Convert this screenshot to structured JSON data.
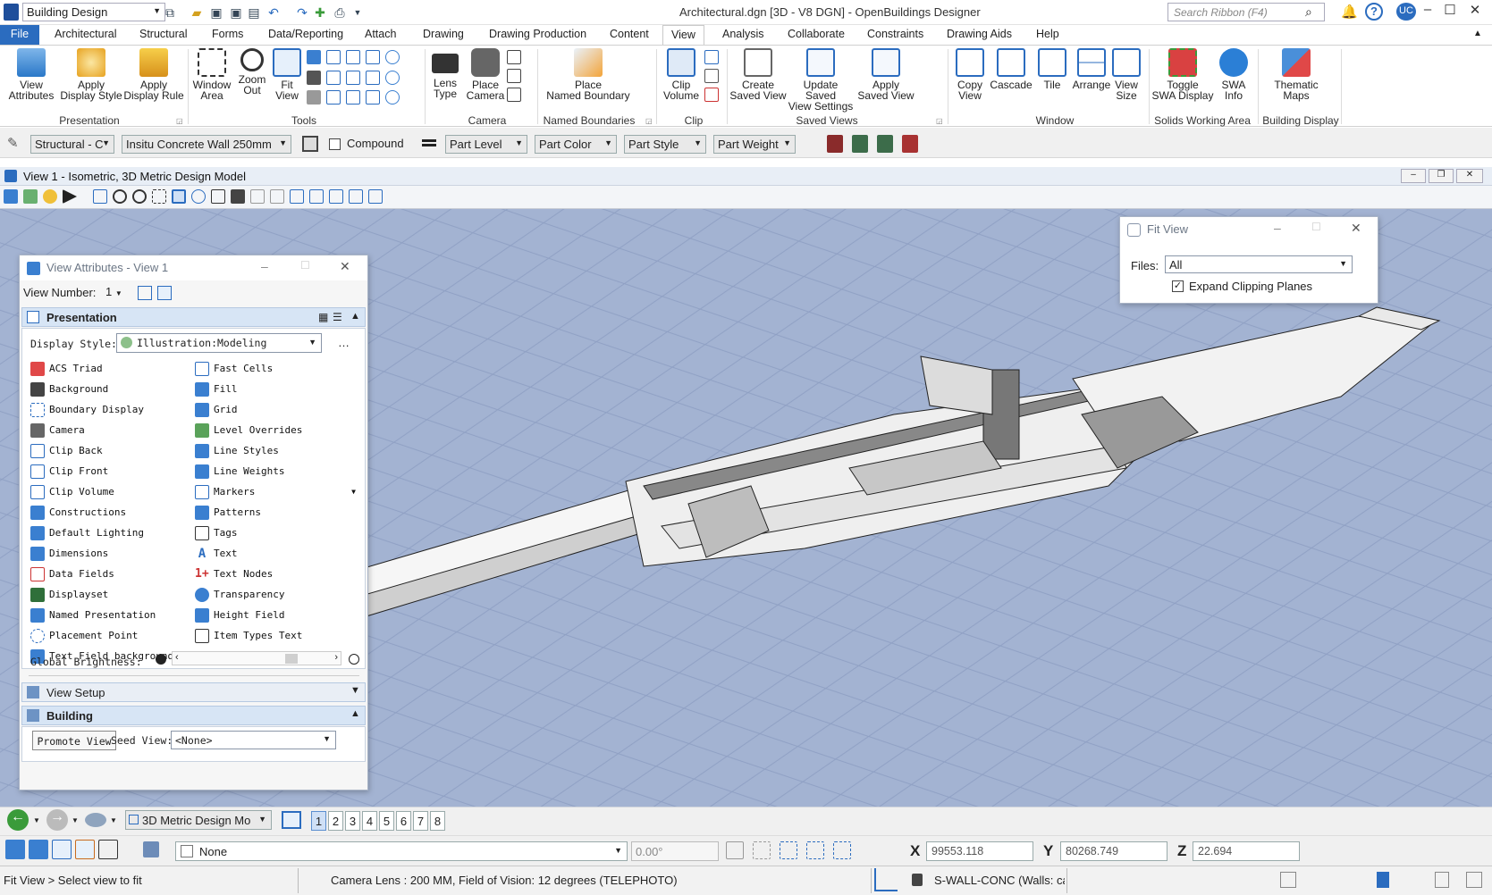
{
  "titlebar": {
    "workspace": "Building Design",
    "title": "Architectural.dgn [3D - V8 DGN] - OpenBuildings Designer",
    "search_placeholder": "Search Ribbon (F4)",
    "user_initials": "UC"
  },
  "tabs": [
    "File",
    "Architectural",
    "Structural",
    "Forms",
    "Data/Reporting",
    "Attach",
    "Drawing",
    "Drawing Production",
    "Content",
    "View",
    "Analysis",
    "Collaborate",
    "Constraints",
    "Drawing Aids",
    "Help"
  ],
  "ribbon": {
    "presentation": {
      "label": "Presentation",
      "view_attributes": "View\nAttributes",
      "apply_display_style": "Apply\nDisplay Style",
      "apply_display_rule": "Apply\nDisplay Rule"
    },
    "tools": {
      "label": "Tools",
      "window_area": "Window\nArea",
      "zoom_out": "Zoom\nOut",
      "fit_view": "Fit\nView"
    },
    "camera": {
      "label": "Camera",
      "lens_type": "Lens\nType",
      "place_camera": "Place\nCamera"
    },
    "named_boundaries": {
      "label": "Named Boundaries",
      "place": "Place\nNamed Boundary"
    },
    "clip": {
      "label": "Clip",
      "clip_volume": "Clip\nVolume"
    },
    "saved_views": {
      "label": "Saved Views",
      "create": "Create\nSaved View",
      "update": "Update Saved\nView Settings",
      "apply": "Apply\nSaved View"
    },
    "window": {
      "label": "Window",
      "copy_view": "Copy\nView",
      "cascade": "Cascade",
      "tile": "Tile",
      "arrange": "Arrange",
      "view_size": "View\nSize"
    },
    "swa": {
      "label": "Solids Working Area",
      "toggle": "Toggle\nSWA Display",
      "info": "SWA\nInfo"
    },
    "building_display": {
      "label": "Building Display",
      "thematic_maps": "Thematic\nMaps"
    }
  },
  "attrbar": {
    "family": "Structural - C",
    "part": "Insitu Concrete Wall 250mm",
    "compound": "Compound",
    "part_level": "Part Level",
    "part_color": "Part Color",
    "part_style": "Part Style",
    "part_weight": "Part Weight"
  },
  "view": {
    "title": "View 1 - Isometric, 3D Metric Design Model"
  },
  "fit_view_dialog": {
    "title": "Fit View",
    "files_label": "Files:",
    "files_value": "All",
    "expand_clipping": "Expand Clipping Planes",
    "expand_checked": true
  },
  "view_attributes_dialog": {
    "title": "View Attributes - View 1",
    "view_number_label": "View Number:",
    "view_number": "1",
    "presentation_header": "Presentation",
    "display_style_label": "Display Style:",
    "display_style": "Illustration:Modeling",
    "left_items": [
      "ACS Triad",
      "Background",
      "Boundary Display",
      "Camera",
      "Clip Back",
      "Clip Front",
      "Clip Volume",
      "Constructions",
      "Default Lighting",
      "Dimensions",
      "Data Fields",
      "Displayset",
      "Named Presentation",
      "Placement Point",
      "Text Field background"
    ],
    "right_items": [
      "Fast Cells",
      "Fill",
      "Grid",
      "Level Overrides",
      "Line Styles",
      "Line Weights",
      "Markers",
      "Patterns",
      "Tags",
      "Text",
      "Text Nodes",
      "Transparency",
      "Height Field",
      "Item Types Text"
    ],
    "brightness_label": "Global Brightness:",
    "brightness_fraction": 0.7,
    "view_setup": "View Setup",
    "building": "Building",
    "promote_view": "Promote View",
    "seed_view_label": "Seed View:",
    "seed_view": "<None>"
  },
  "viewbar": {
    "model": "3D Metric Design Mo",
    "view_numbers": [
      "1",
      "2",
      "3",
      "4",
      "5",
      "6",
      "7",
      "8"
    ],
    "active_view": "1"
  },
  "toolbar2": {
    "level": "None",
    "angle": "0.00°",
    "x_label": "X",
    "x": "99553.118",
    "y_label": "Y",
    "y": "80268.749",
    "z_label": "Z",
    "z": "22.694"
  },
  "status": {
    "prompt": "Fit View > Select view to fit",
    "message": "Camera Lens : 200 MM, Field of Vision: 12 degrees (TELEPHOTO)",
    "element": "S-WALL-CONC (Walls: ca"
  },
  "colors": {
    "accent": "#2b6cbf",
    "viewport": "#a3b3d2",
    "section": "#d7e5f5"
  }
}
